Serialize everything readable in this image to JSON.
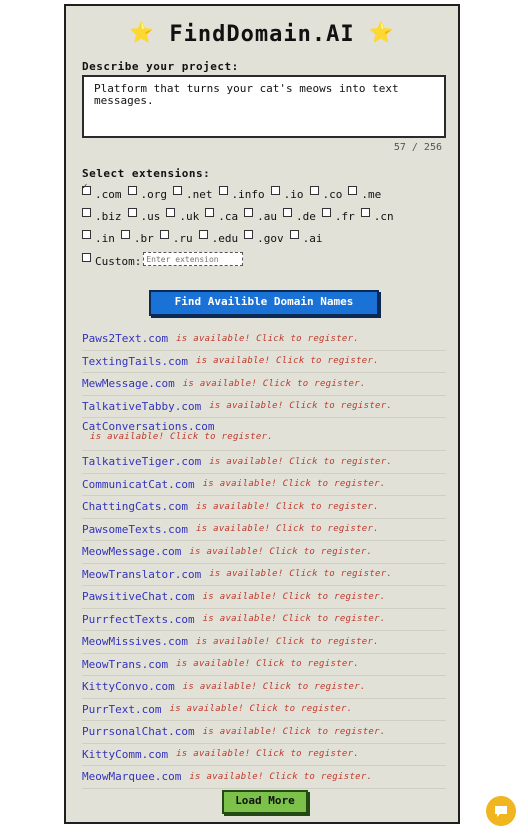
{
  "header": {
    "title": "FindDomain.AI",
    "star_left": "⭐",
    "star_right": "⭐"
  },
  "project": {
    "label": "Describe your project:",
    "value": "Platform that turns your cat's meows into text messages.",
    "counter": "57 / 256"
  },
  "extensions": {
    "label": "Select extensions:",
    "rows": [
      [
        {
          "name": ".com",
          "checked": true
        },
        {
          "name": ".org"
        },
        {
          "name": ".net"
        },
        {
          "name": ".info"
        },
        {
          "name": ".io"
        },
        {
          "name": ".co"
        },
        {
          "name": ".me"
        }
      ],
      [
        {
          "name": ".biz"
        },
        {
          "name": ".us"
        },
        {
          "name": ".uk"
        },
        {
          "name": ".ca"
        },
        {
          "name": ".au"
        },
        {
          "name": ".de"
        },
        {
          "name": ".fr"
        },
        {
          "name": ".cn"
        }
      ],
      [
        {
          "name": ".in"
        },
        {
          "name": ".br"
        },
        {
          "name": ".ru"
        },
        {
          "name": ".edu"
        },
        {
          "name": ".gov"
        },
        {
          "name": ".ai"
        }
      ]
    ],
    "custom_label": "Custom:",
    "custom_placeholder": "Enter extension"
  },
  "find_button": "Find Availible Domain Names",
  "results": {
    "available_text": "is available! Click to register.",
    "domains": [
      "Paws2Text.com",
      "TextingTails.com",
      "MewMessage.com",
      "TalkativeTabby.com",
      "CatConversations.com",
      "TalkativeTiger.com",
      "CommunicatCat.com",
      "ChattingCats.com",
      "PawsomeTexts.com",
      "MeowMessage.com",
      "MeowTranslator.com",
      "PawsitiveChat.com",
      "PurrfectTexts.com",
      "MeowMissives.com",
      "MeowTrans.com",
      "KittyConvo.com",
      "PurrText.com",
      "PurrsonalChat.com",
      "KittyComm.com",
      "MeowMarquee.com"
    ]
  },
  "load_more": "Load More",
  "colors": {
    "panel": "#e2e1d8",
    "link": "#3333bb",
    "available": "#c0392b",
    "find_button": "#1b72d6",
    "load_button": "#7cc24a",
    "chat": "#f0b51f"
  },
  "icons": {
    "chat": "chat-bubble-icon",
    "star": "star-icon"
  }
}
